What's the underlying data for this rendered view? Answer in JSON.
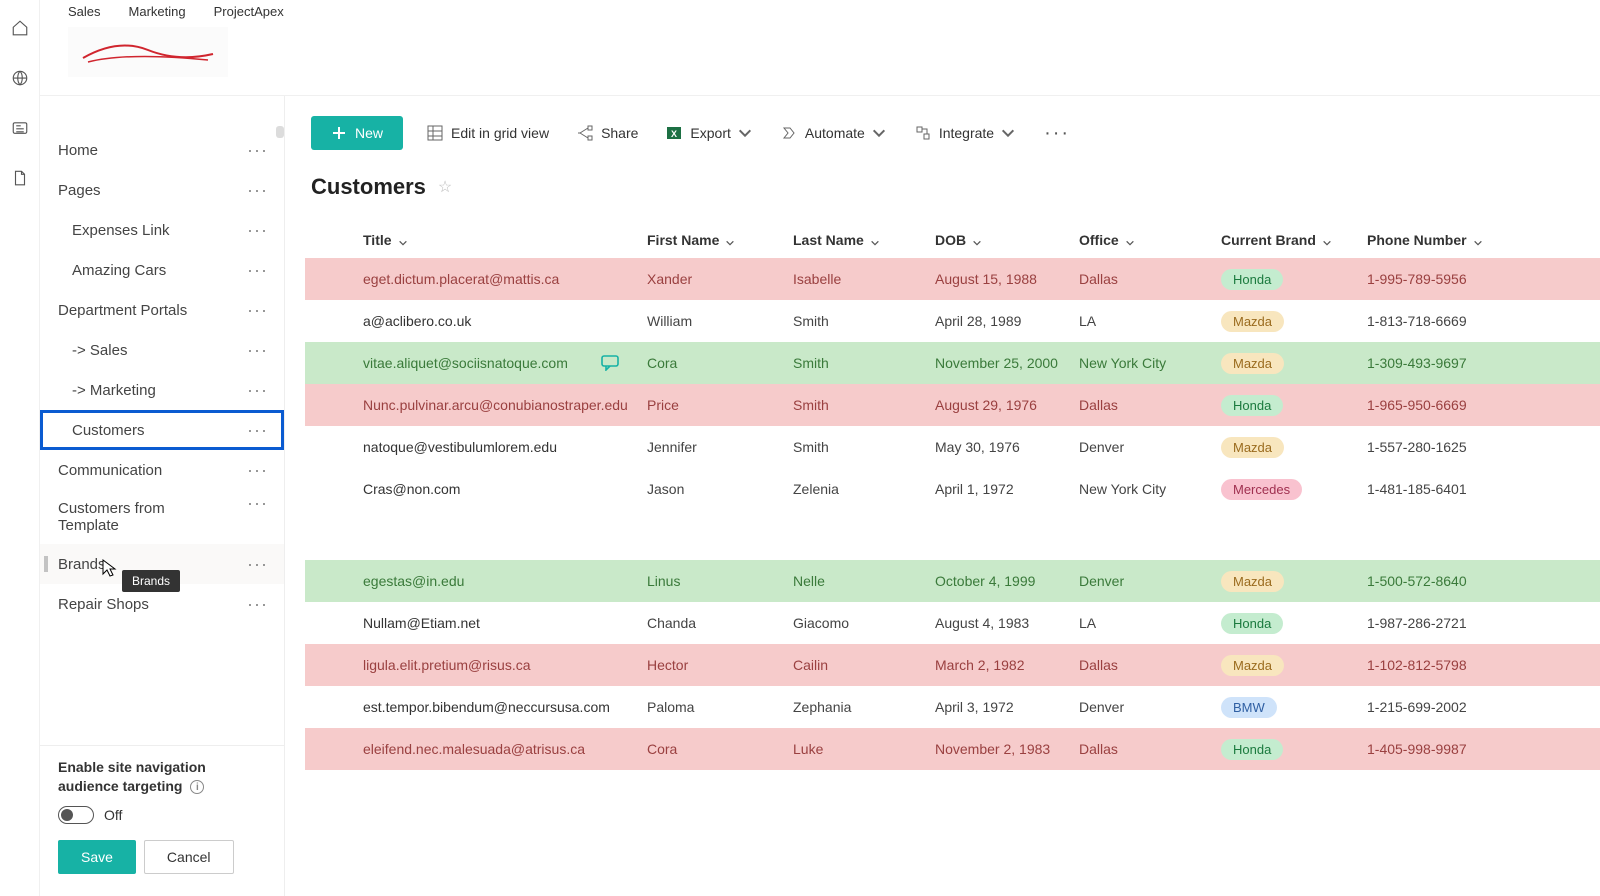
{
  "topTabs": [
    "Sales",
    "Marketing",
    "ProjectApex"
  ],
  "rail": {
    "items": [
      "home-icon",
      "globe-icon",
      "news-icon",
      "document-icon"
    ]
  },
  "sidebar": {
    "items": [
      {
        "label": "Home",
        "sub": false
      },
      {
        "label": "Pages",
        "sub": false
      },
      {
        "label": "Expenses Link",
        "sub": true
      },
      {
        "label": "Amazing Cars",
        "sub": true
      },
      {
        "label": "Department Portals",
        "sub": false
      },
      {
        "label": "-> Sales",
        "sub": true
      },
      {
        "label": "-> Marketing",
        "sub": true
      },
      {
        "label": "Customers",
        "sub": true,
        "selected": true
      },
      {
        "label": "Communication",
        "sub": false
      },
      {
        "label": "Customers from Template",
        "sub": false
      },
      {
        "label": "Brands",
        "sub": false,
        "hover": true,
        "tooltip": "Brands"
      },
      {
        "label": "Repair Shops",
        "sub": false
      }
    ],
    "targeting": {
      "label": "Enable site navigation audience targeting",
      "toggleState": "Off"
    },
    "buttons": {
      "save": "Save",
      "cancel": "Cancel"
    }
  },
  "toolbar": {
    "new": "New",
    "editGrid": "Edit in grid view",
    "share": "Share",
    "export": "Export",
    "automate": "Automate",
    "integrate": "Integrate"
  },
  "page": {
    "title": "Customers"
  },
  "table": {
    "columns": [
      "Title",
      "First Name",
      "Last Name",
      "DOB",
      "Office",
      "Current Brand",
      "Phone Number"
    ],
    "rows": [
      {
        "title": "eget.dictum.placerat@mattis.ca",
        "first": "Xander",
        "last": "Isabelle",
        "dob": "August 15, 1988",
        "office": "Dallas",
        "brand": "Honda",
        "phone": "1-995-789-5956",
        "rowColor": "red"
      },
      {
        "title": "a@aclibero.co.uk",
        "first": "William",
        "last": "Smith",
        "dob": "April 28, 1989",
        "office": "LA",
        "brand": "Mazda",
        "phone": "1-813-718-6669",
        "rowColor": ""
      },
      {
        "title": "vitae.aliquet@sociisnatoque.com",
        "first": "Cora",
        "last": "Smith",
        "dob": "November 25, 2000",
        "office": "New York City",
        "brand": "Mazda",
        "phone": "1-309-493-9697",
        "rowColor": "green",
        "comment": true
      },
      {
        "title": "Nunc.pulvinar.arcu@conubianostraper.edu",
        "first": "Price",
        "last": "Smith",
        "dob": "August 29, 1976",
        "office": "Dallas",
        "brand": "Honda",
        "phone": "1-965-950-6669",
        "rowColor": "red"
      },
      {
        "title": "natoque@vestibulumlorem.edu",
        "first": "Jennifer",
        "last": "Smith",
        "dob": "May 30, 1976",
        "office": "Denver",
        "brand": "Mazda",
        "phone": "1-557-280-1625",
        "rowColor": ""
      },
      {
        "title": "Cras@non.com",
        "first": "Jason",
        "last": "Zelenia",
        "dob": "April 1, 1972",
        "office": "New York City",
        "brand": "Mercedes",
        "phone": "1-481-185-6401",
        "rowColor": ""
      },
      {
        "spacer": true
      },
      {
        "title": "egestas@in.edu",
        "first": "Linus",
        "last": "Nelle",
        "dob": "October 4, 1999",
        "office": "Denver",
        "brand": "Mazda",
        "phone": "1-500-572-8640",
        "rowColor": "green"
      },
      {
        "title": "Nullam@Etiam.net",
        "first": "Chanda",
        "last": "Giacomo",
        "dob": "August 4, 1983",
        "office": "LA",
        "brand": "Honda",
        "phone": "1-987-286-2721",
        "rowColor": ""
      },
      {
        "title": "ligula.elit.pretium@risus.ca",
        "first": "Hector",
        "last": "Cailin",
        "dob": "March 2, 1982",
        "office": "Dallas",
        "brand": "Mazda",
        "phone": "1-102-812-5798",
        "rowColor": "red"
      },
      {
        "title": "est.tempor.bibendum@neccursusa.com",
        "first": "Paloma",
        "last": "Zephania",
        "dob": "April 3, 1972",
        "office": "Denver",
        "brand": "BMW",
        "phone": "1-215-699-2002",
        "rowColor": ""
      },
      {
        "title": "eleifend.nec.malesuada@atrisus.ca",
        "first": "Cora",
        "last": "Luke",
        "dob": "November 2, 1983",
        "office": "Dallas",
        "brand": "Honda",
        "phone": "1-405-998-9987",
        "rowColor": "red"
      }
    ]
  },
  "brandColors": {
    "Honda": "honda",
    "Mazda": "mazda",
    "Mercedes": "mercedes",
    "BMW": "bmw"
  }
}
